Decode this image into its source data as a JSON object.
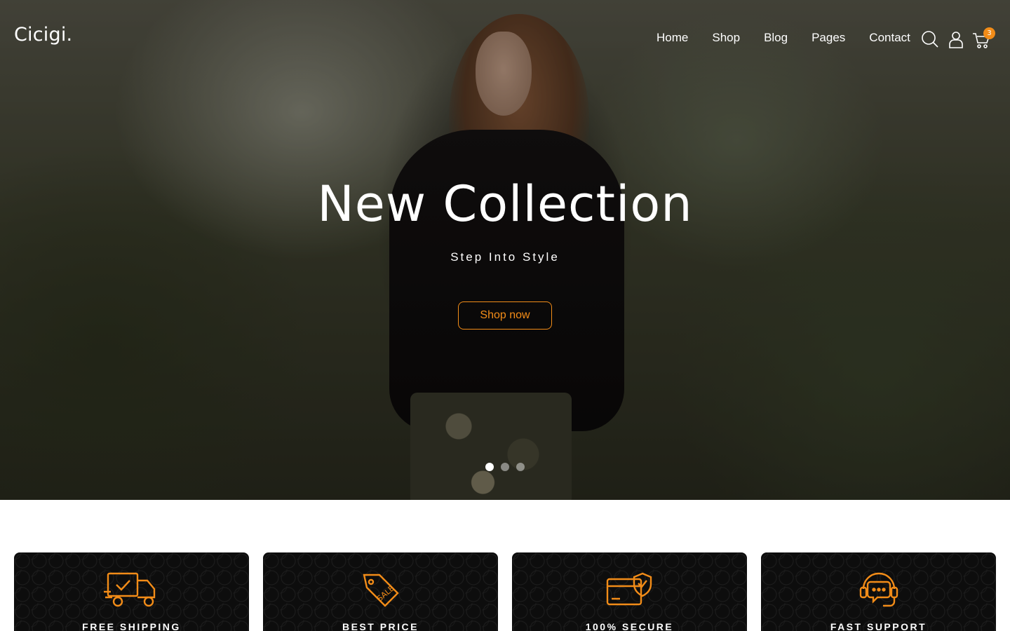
{
  "brand": {
    "logo": "Cicigi.",
    "accent_color": "#f28c18"
  },
  "nav": {
    "items": [
      {
        "label": "Home"
      },
      {
        "label": "Shop"
      },
      {
        "label": "Blog"
      },
      {
        "label": "Pages"
      },
      {
        "label": "Contact"
      }
    ],
    "icons": [
      "search-icon",
      "user-icon",
      "cart-icon"
    ],
    "cart_count": "3"
  },
  "hero": {
    "title": "New Collection",
    "subtitle": "Step Into Style",
    "cta_label": "Shop now",
    "slides": 3,
    "active_slide": 1
  },
  "features": [
    {
      "label": "FREE SHIPPING",
      "icon": "truck-icon"
    },
    {
      "label": "BEST PRICE",
      "icon": "sale-tag-icon"
    },
    {
      "label": "100% SECURE",
      "icon": "secure-card-icon"
    },
    {
      "label": "FAST SUPPORT",
      "icon": "headset-icon"
    }
  ]
}
